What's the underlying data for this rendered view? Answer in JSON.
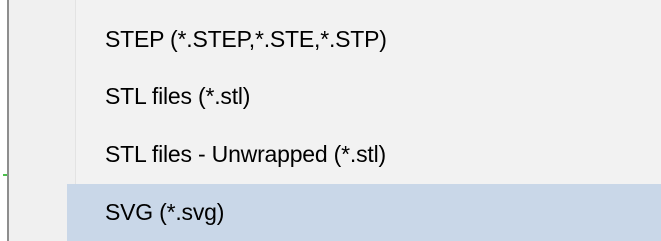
{
  "menu": {
    "items": [
      {
        "label": "STEP (*.STEP,*.STE,*.STP)",
        "highlighted": false
      },
      {
        "label": "STL files (*.stl)",
        "highlighted": false
      },
      {
        "label": "STL files - Unwrapped (*.stl)",
        "highlighted": false
      },
      {
        "label": "SVG (*.svg)",
        "highlighted": true
      }
    ],
    "highlight_color": "#c9d7e8"
  }
}
